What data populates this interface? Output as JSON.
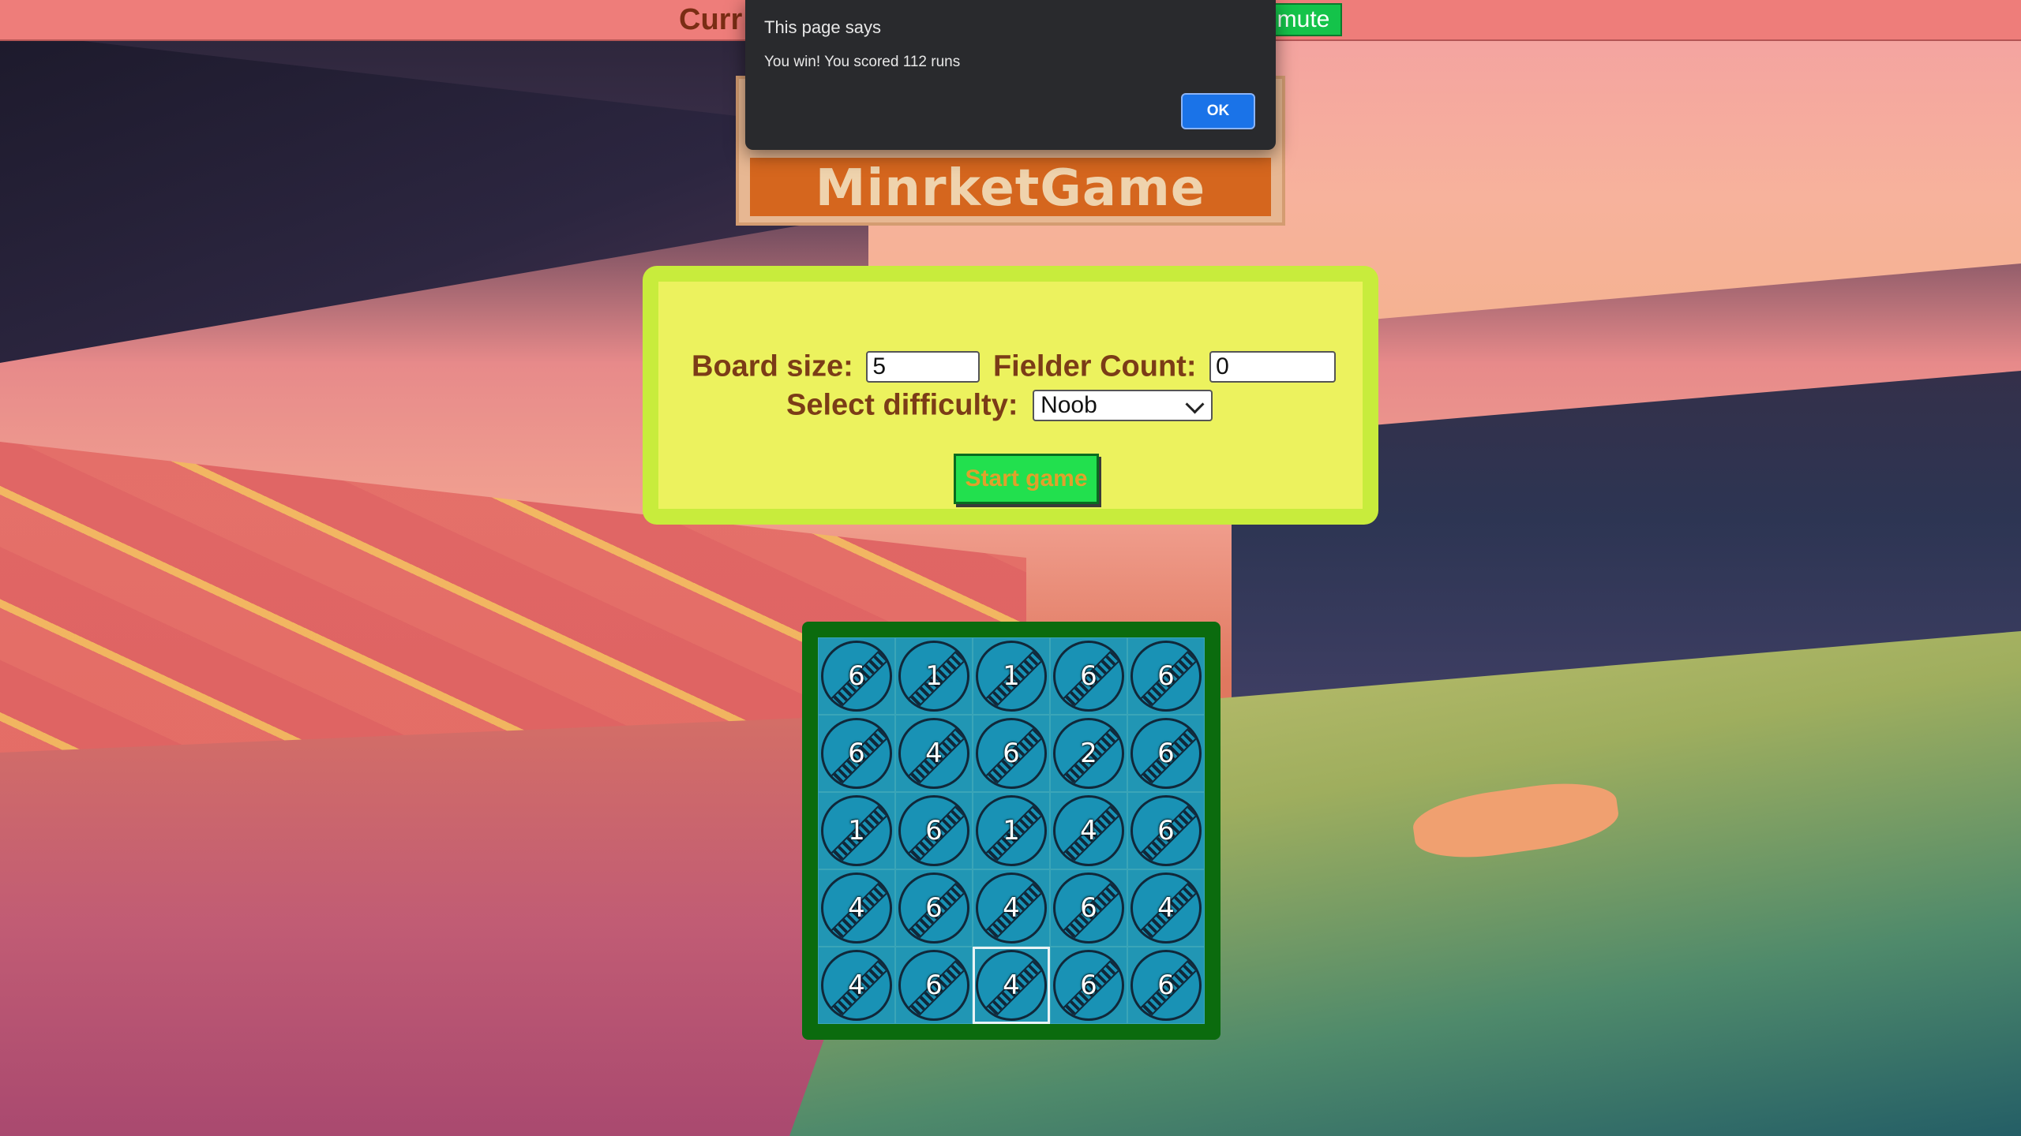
{
  "topbar": {
    "current_label": "Curr",
    "mute_label": "mute"
  },
  "logo": {
    "title": "MinrketGame"
  },
  "settings": {
    "board_size_label": "Board size:",
    "board_size_value": "5",
    "fielder_count_label": "Fielder Count:",
    "fielder_count_value": "0",
    "difficulty_label": "Select difficulty:",
    "difficulty_value": "Noob",
    "start_label": "Start game"
  },
  "board": {
    "rows": [
      [
        "6",
        "1",
        "1",
        "6",
        "6"
      ],
      [
        "6",
        "4",
        "6",
        "2",
        "6"
      ],
      [
        "1",
        "6",
        "1",
        "4",
        "6"
      ],
      [
        "4",
        "6",
        "4",
        "6",
        "4"
      ],
      [
        "4",
        "6",
        "4",
        "6",
        "6"
      ]
    ],
    "selected_cell": {
      "row": 5,
      "col": 3
    }
  },
  "dialog": {
    "title": "This page says",
    "message": "You win! You scored 112 runs",
    "ok_label": "OK"
  },
  "colors": {
    "topbar": "#ee7d7a",
    "panel": "#ecf25e",
    "panel_border": "#c8ec3c",
    "board_frame": "#0b6b0e",
    "board_bg": "#2196b4",
    "label_text": "#7b3c17",
    "start_button": "#22e04e",
    "ok_button": "#1a73e8"
  },
  "icons": [
    "cricket-ball-icon",
    "chevron-down-icon"
  ]
}
